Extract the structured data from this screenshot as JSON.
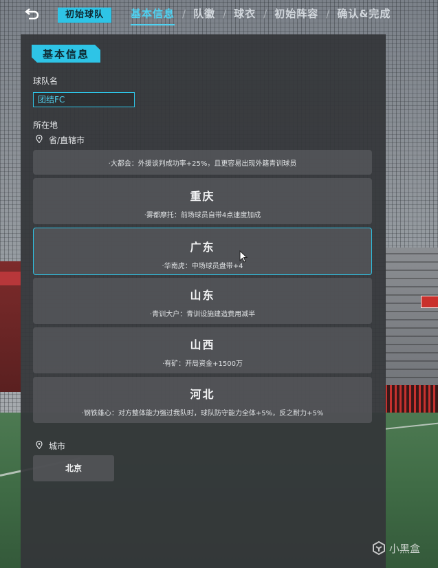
{
  "nav": {
    "team_tag": "初始球队",
    "steps": [
      {
        "label": "基本信息",
        "active": true
      },
      {
        "label": "队徽",
        "active": false
      },
      {
        "label": "球衣",
        "active": false
      },
      {
        "label": "初始阵容",
        "active": false
      },
      {
        "label": "确认&完成",
        "active": false
      }
    ],
    "separator": "/"
  },
  "panel": {
    "title": "基本信息",
    "team_name_label": "球队名",
    "team_name_value": "团结FC",
    "location_label": "所在地",
    "province_label": "省/直辖市",
    "provinces": [
      {
        "name": "",
        "desc": "·大都会：外援谈判成功率+25%，且更容易出现外籍青训球员",
        "selected": false
      },
      {
        "name": "重庆",
        "desc": "·雾都摩托：前场球员自带4点速度加成",
        "selected": false
      },
      {
        "name": "广东",
        "desc": "·华南虎：中场球员盘带+4",
        "selected": true
      },
      {
        "name": "山东",
        "desc": "·青训大户：青训设施建造费用减半",
        "selected": false
      },
      {
        "name": "山西",
        "desc": "·有矿：开局资金+1500万",
        "selected": false
      },
      {
        "name": "河北",
        "desc": "·钢铁雄心：对方整体能力强过我队时，球队防守能力全体+5%，反之耐力+5%",
        "selected": false
      }
    ],
    "city_label": "城市",
    "city_value": "北京"
  },
  "watermark": "小黑盒",
  "colors": {
    "accent": "#2ec4e6",
    "panel_bg": "#343639",
    "option_bg": "#585a5d"
  }
}
